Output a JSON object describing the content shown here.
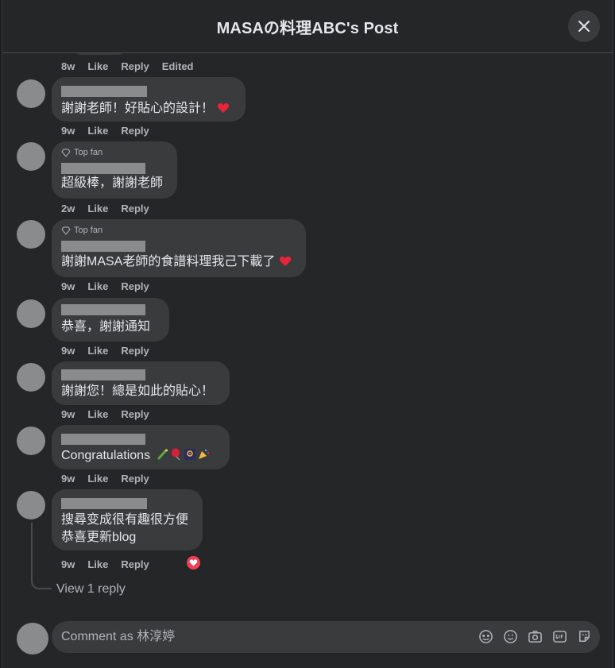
{
  "header": {
    "title": "MASAの料理ABC's Post"
  },
  "labels": {
    "like": "Like",
    "reply": "Reply",
    "edited": "Edited",
    "top_fan": "Top fan"
  },
  "first_meta": {
    "time": "8w"
  },
  "comments": [
    {
      "text": "謝謝老師！好貼心的設計！",
      "time": "9w"
    },
    {
      "text": "超級棒，謝謝老師",
      "time": "2w"
    },
    {
      "text": "謝謝MASA老師的食譜料理我己下載了",
      "time": "9w"
    },
    {
      "text": "恭喜，謝謝通知",
      "time": "9w"
    },
    {
      "text": "謝謝您！總是如此的貼心！",
      "time": "9w"
    },
    {
      "text": "Congratulations",
      "time": "9w"
    },
    {
      "line1": "搜尋变成很有趣很方便",
      "line2": "恭喜更新blog",
      "time": "9w"
    }
  ],
  "thread": {
    "view_reply": "View 1 reply"
  },
  "composer": {
    "placeholder": "Comment as 林淳婷"
  },
  "colors": {
    "accent_heart": "#f33e58",
    "bubble": "#3a3b3c",
    "background": "#252628"
  }
}
